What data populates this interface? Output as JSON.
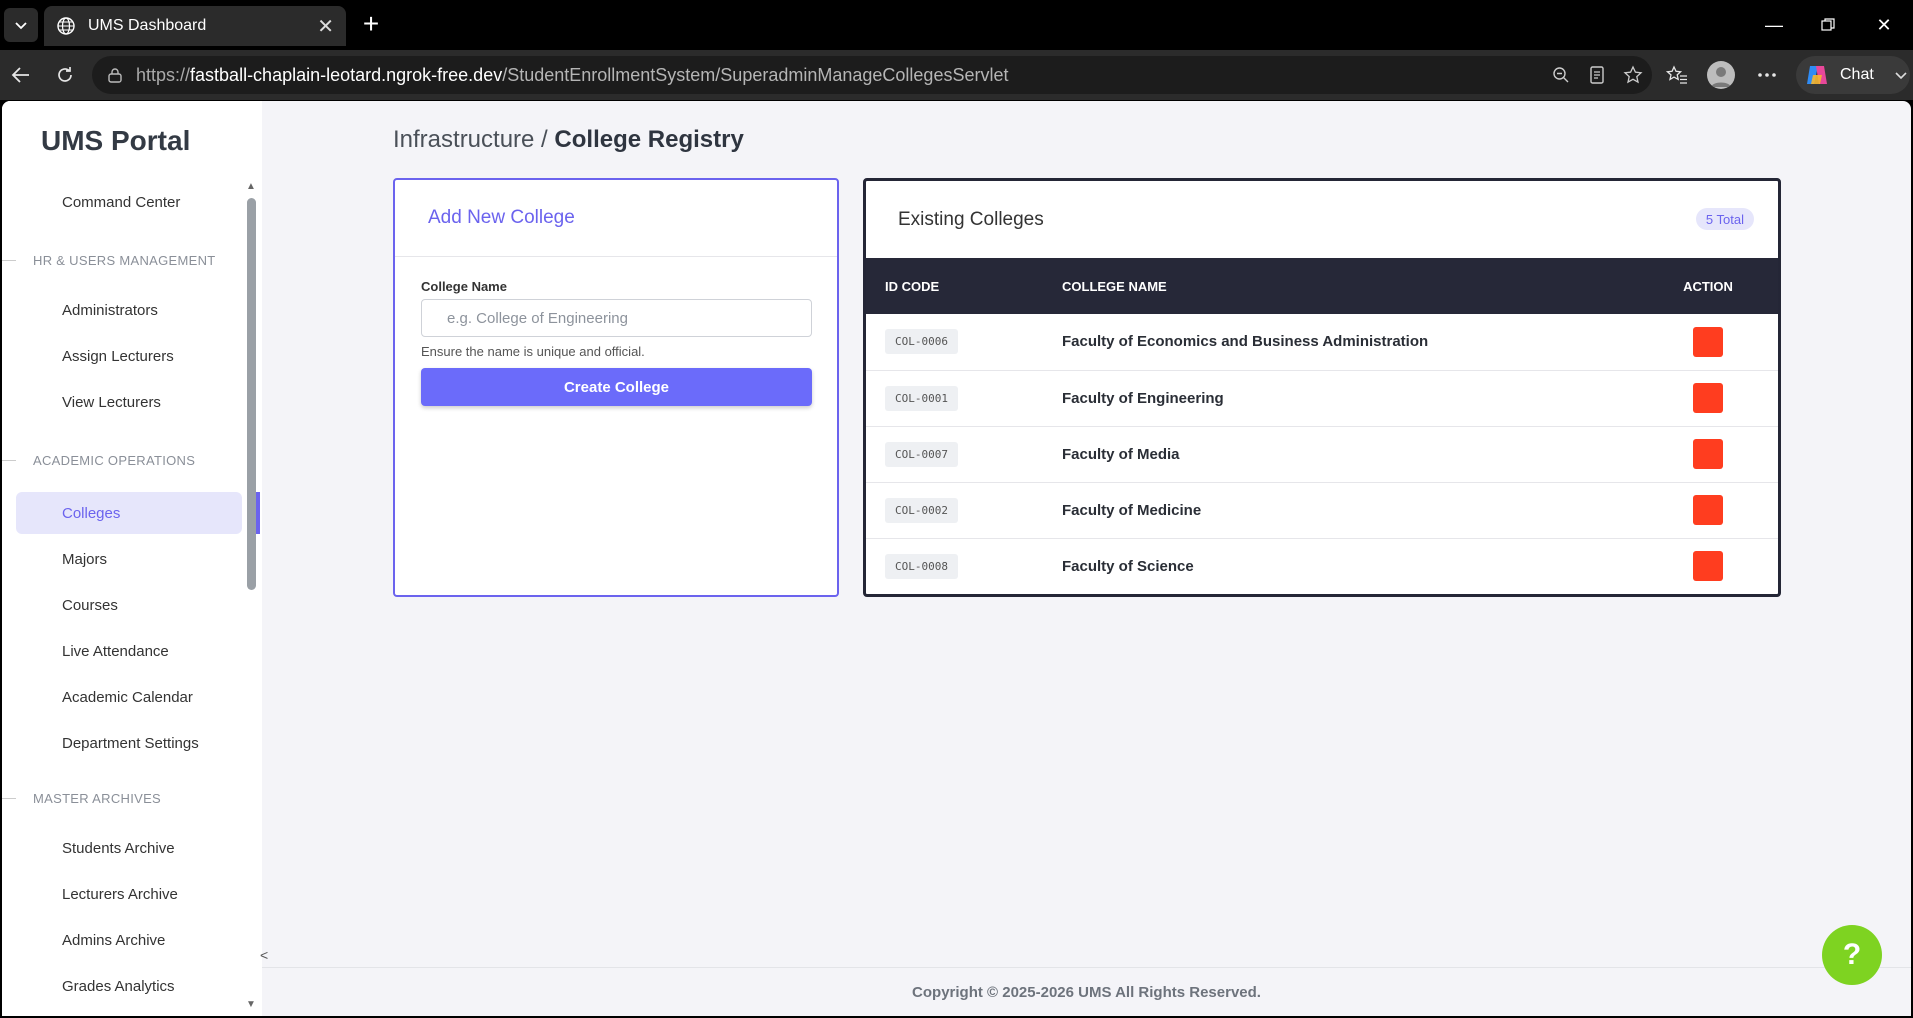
{
  "browser": {
    "tab_title": "UMS Dashboard",
    "url_scheme": "https://",
    "url_host": "fastball-chaplain-leotard.ngrok-free.dev",
    "url_path": "/StudentEnrollmentSystem/SuperadminManageCollegesServlet",
    "chat_label": "Chat"
  },
  "sidebar": {
    "brand": "UMS Portal",
    "command_center": "Command Center",
    "sections": {
      "hr": "HR & USERS MANAGEMENT",
      "academic": "ACADEMIC OPERATIONS",
      "archives": "MASTER ARCHIVES"
    },
    "hr_items": [
      "Administrators",
      "Assign Lecturers",
      "View Lecturers"
    ],
    "academic_items": [
      "Colleges",
      "Majors",
      "Courses",
      "Live Attendance",
      "Academic Calendar",
      "Department Settings"
    ],
    "archive_items": [
      "Students Archive",
      "Lecturers Archive",
      "Admins Archive",
      "Grades Analytics"
    ],
    "active_item": "Colleges",
    "collapse_glyph": "<"
  },
  "breadcrumb": {
    "parent": "Infrastructure",
    "separator": " / ",
    "current": "College Registry"
  },
  "add_form": {
    "title": "Add New College",
    "field_label": "College Name",
    "field_value": "",
    "field_placeholder": "e.g. College of Engineering",
    "help_text": "Ensure the name is unique and official.",
    "submit_label": "Create College"
  },
  "college_list": {
    "title": "Existing Colleges",
    "total_badge": "5 Total",
    "columns": [
      "ID CODE",
      "COLLEGE NAME",
      "ACTION"
    ],
    "rows": [
      {
        "id": "COL-0006",
        "name": "Faculty of Economics and Business Administration"
      },
      {
        "id": "COL-0001",
        "name": "Faculty of Engineering"
      },
      {
        "id": "COL-0007",
        "name": "Faculty of Media"
      },
      {
        "id": "COL-0002",
        "name": "Faculty of Medicine"
      },
      {
        "id": "COL-0008",
        "name": "Faculty of Science"
      }
    ]
  },
  "footer": {
    "copyright": "Copyright © 2025-2026 UMS All Rights Reserved."
  },
  "help_fab": {
    "label": "?"
  },
  "colors": {
    "accent": "#6b63ee",
    "primary_button": "#6b6bfa",
    "table_header": "#262838",
    "delete": "#ff3d1f",
    "help_fab": "#7ed321"
  }
}
